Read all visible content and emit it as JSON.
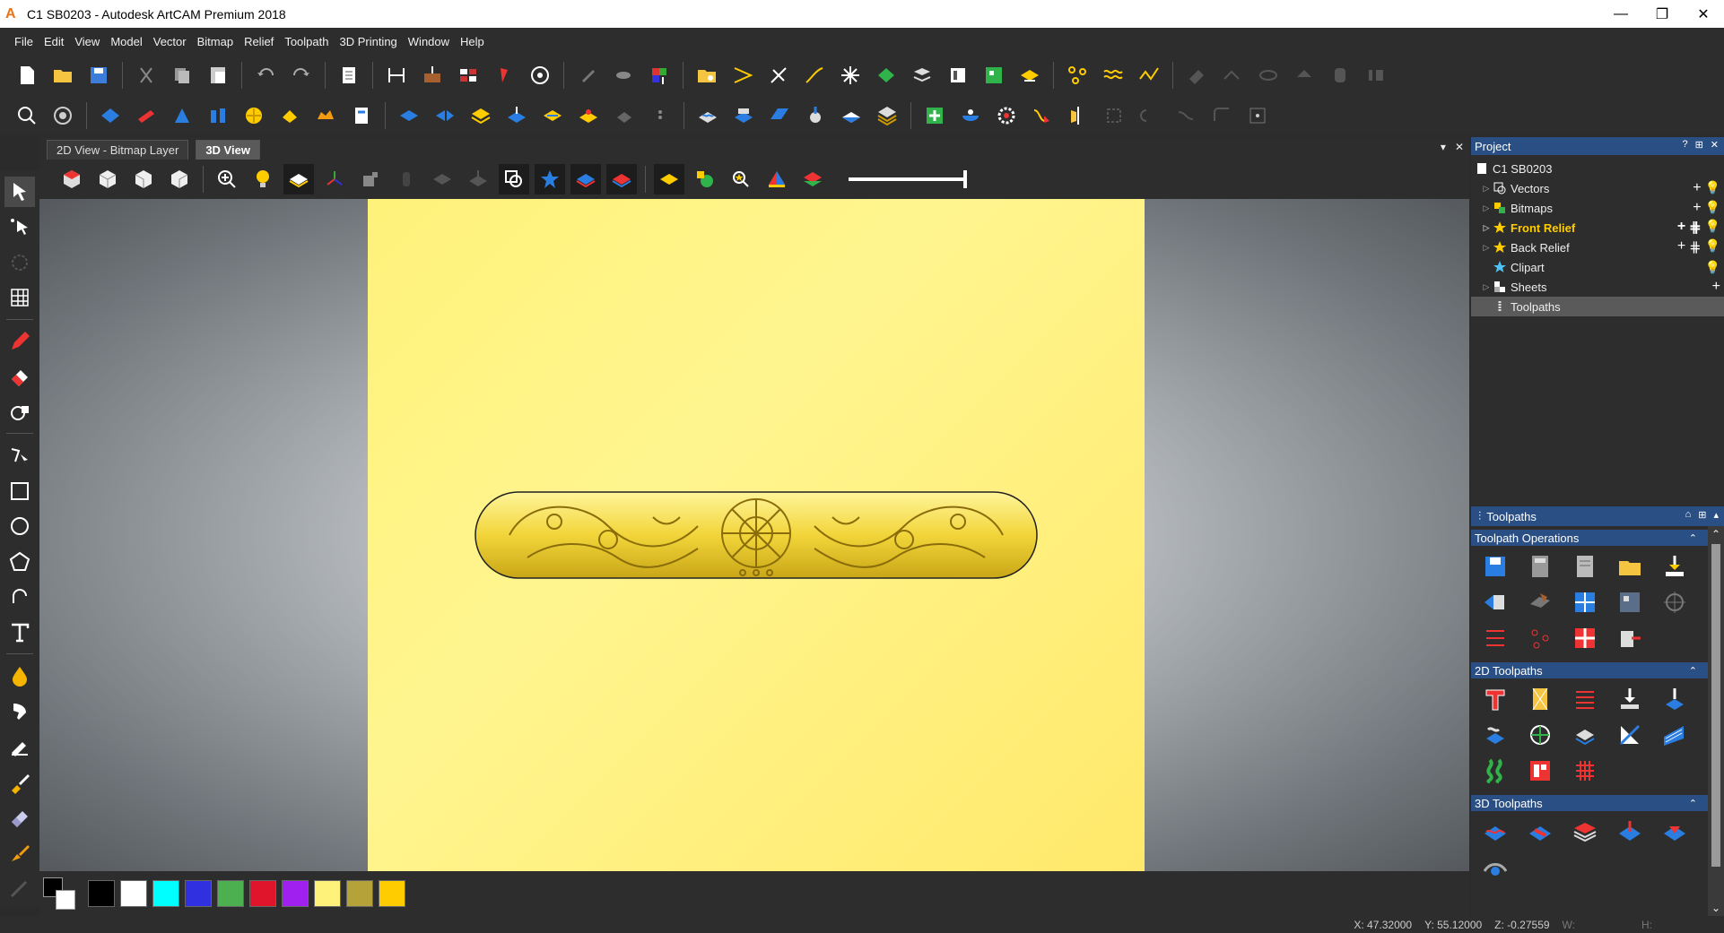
{
  "window": {
    "title": "C1 SB0203 - Autodesk ArtCAM Premium 2018",
    "minimize": "—",
    "maximize": "❐",
    "close": "✕"
  },
  "menu": [
    "File",
    "Edit",
    "View",
    "Model",
    "Vector",
    "Bitmap",
    "Relief",
    "Toolpath",
    "3D Printing",
    "Window",
    "Help"
  ],
  "tabs": {
    "tab1": "2D View - Bitmap Layer",
    "tab2": "3D View",
    "dropdown": "▾",
    "close": "✕"
  },
  "project": {
    "title": "Project",
    "help": "?",
    "pin": "⊞",
    "close": "✕",
    "root": "C1 SB0203",
    "items": [
      {
        "label": "Vectors"
      },
      {
        "label": "Bitmaps"
      },
      {
        "label": "Front Relief"
      },
      {
        "label": "Back Relief"
      },
      {
        "label": "Clipart"
      },
      {
        "label": "Sheets"
      },
      {
        "label": "Toolpaths"
      }
    ]
  },
  "toolpaths": {
    "title": "Toolpaths",
    "sections": {
      "ops": "Toolpath Operations",
      "twod": "2D Toolpaths",
      "threed": "3D Toolpaths"
    }
  },
  "status": {
    "x": "X: 47.32000",
    "y": "Y: 55.12000",
    "z": "Z: -0.27559",
    "w": "W:",
    "h": "H:"
  },
  "palette": [
    "#000000",
    "#ffffff",
    "#00ffff",
    "#3030e0",
    "#4caf50",
    "#e0142a",
    "#a020f0",
    "#fff27a",
    "#b5a33a",
    "#ffcc00"
  ],
  "colors": {
    "accent": "#2a4f84",
    "sheet": "#fff27a",
    "relief": "#f2d53a"
  }
}
